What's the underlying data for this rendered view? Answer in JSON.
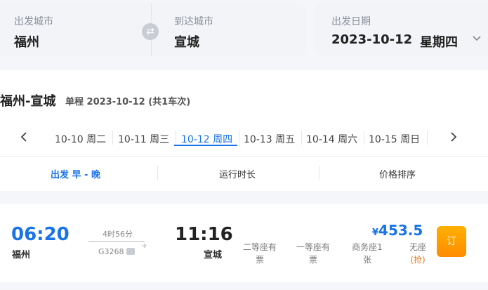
{
  "search": {
    "from_label": "出发城市",
    "from_city": "福州",
    "to_label": "到达城市",
    "to_city": "宣城",
    "date_label": "出发日期",
    "date_value": "2023-10-12",
    "weekday": "星期四"
  },
  "route": {
    "title": "福州-宣城",
    "summary": "单程 2023-10-12 (共1车次)"
  },
  "date_tabs": [
    {
      "label": "10-10 周二",
      "active": false
    },
    {
      "label": "10-11 周三",
      "active": false
    },
    {
      "label": "10-12 周四",
      "active": true
    },
    {
      "label": "10-13 周五",
      "active": false
    },
    {
      "label": "10-14 周六",
      "active": false
    },
    {
      "label": "10-15 周日",
      "active": false
    }
  ],
  "sort_tabs": [
    "出发 早 - 晚",
    "运行时长",
    "价格排序"
  ],
  "train": {
    "depart_time": "06:20",
    "depart_station": "福州",
    "duration": "4时56分",
    "train_no": "G3268",
    "arrive_time": "11:16",
    "arrive_station": "宣城",
    "price_symbol": "¥",
    "price": "453.5",
    "seats": [
      {
        "line1": "二等座有",
        "line2": "票"
      },
      {
        "line1": "一等座有",
        "line2": "票"
      },
      {
        "line1": "商务座1",
        "line2": "张"
      },
      {
        "line1": "无座",
        "line2": "(抢)"
      }
    ],
    "book_label": "订"
  }
}
